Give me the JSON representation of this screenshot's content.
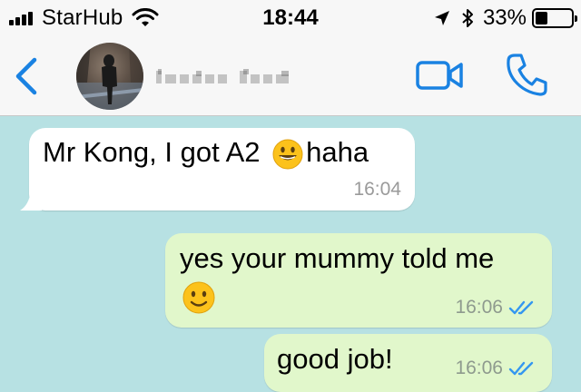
{
  "status_bar": {
    "carrier": "StarHub",
    "time": "18:44",
    "battery_pct": "33%",
    "battery_level": 0.33,
    "signal_bars": 4
  },
  "header": {
    "contact_name": "",
    "back_icon": "chevron-left-icon",
    "video_icon": "video-camera-icon",
    "call_icon": "phone-icon"
  },
  "messages": [
    {
      "direction": "in",
      "text": "Mr Kong, I got A2",
      "emoji": "grinning-face",
      "text_after": "haha",
      "time": "16:04"
    },
    {
      "direction": "out",
      "text": "yes your mummy told me",
      "emoji": "slightly-smiling-face",
      "time": "16:06",
      "status": "read"
    },
    {
      "direction": "out",
      "text": "good job!",
      "time": "16:06",
      "status": "read"
    }
  ],
  "colors": {
    "accent": "#1a82e2",
    "chat_background": "#b7e1e3",
    "incoming_bubble": "#ffffff",
    "outgoing_bubble": "#e1f7cb",
    "read_tick": "#3497f0"
  }
}
